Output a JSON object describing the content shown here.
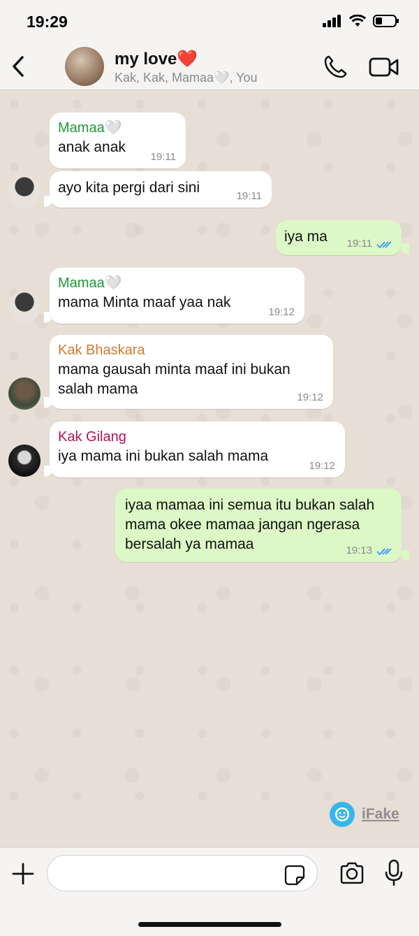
{
  "status_bar": {
    "time": "19:29"
  },
  "header": {
    "title": "my love❤️",
    "subtitle": "Kak, Kak, Mamaa🤍, You"
  },
  "messages": [
    {
      "direction": "incoming",
      "sender": "Mamaa🤍",
      "sender_color": "#1f9a3a",
      "text": "anak anak",
      "time": "19:11"
    },
    {
      "direction": "incoming",
      "sender": "",
      "text": "ayo kita pergi dari sini",
      "time": "19:11"
    },
    {
      "direction": "outgoing",
      "text": "iya ma",
      "time": "19:11",
      "status": "read"
    },
    {
      "direction": "incoming",
      "sender": "Mamaa🤍",
      "sender_color": "#1f9a3a",
      "text": "mama Minta maaf yaa nak",
      "time": "19:12"
    },
    {
      "direction": "incoming",
      "sender": "Kak Bhaskara",
      "sender_color": "#d07a35",
      "text": "mama gausah minta maaf ini bukan salah mama",
      "time": "19:12"
    },
    {
      "direction": "incoming",
      "sender": "Kak Gilang",
      "sender_color": "#b0125a",
      "text": "iya mama ini bukan salah mama",
      "time": "19:12"
    },
    {
      "direction": "outgoing",
      "text": "iyaa mamaa ini semua itu bukan salah mama okee mamaa jangan ngerasa bersalah ya mamaa",
      "time": "19:13",
      "status": "read"
    }
  ],
  "watermark": {
    "label": "iFake"
  },
  "input": {
    "placeholder": "",
    "value": ""
  },
  "colors": {
    "outgoing_bubble": "#dcf8c6",
    "incoming_bubble": "#ffffff",
    "read_ticks": "#3497f9",
    "chat_background": "#e7ded5"
  }
}
